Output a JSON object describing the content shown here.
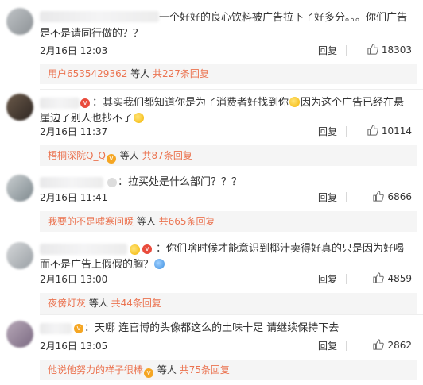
{
  "comments": [
    {
      "text": "一个好好的良心饮料被广告拉下了好多分。。。你们广告是不是请同行做的？？",
      "date": "2月16日 12:03",
      "reply_label": "回复",
      "likes": "18303",
      "thread": {
        "user": "用户6535429362",
        "middle": " 等人 ",
        "count": "共227条回复"
      }
    },
    {
      "text": "：其实我们都知道你是为了消费者好找到你",
      "text2": "因为这个广告已经在悬崖边了别人也抄不了",
      "date": "2月16日 11:37",
      "reply_label": "回复",
      "likes": "10114",
      "thread": {
        "user": "梧桐深院Q_Q",
        "middle": " 等人 ",
        "count": "共87条回复"
      }
    },
    {
      "text": "：拉买处是什么部门？？？",
      "date": "2月16日 11:41",
      "reply_label": "回复",
      "likes": "6866",
      "thread": {
        "user": "我要的不是嘘寒问暖",
        "middle": " 等人 ",
        "count": "共665条回复"
      }
    },
    {
      "text": "：你们啥时候才能意识到椰汁卖得好真的只是因为好喝而不是广告上假假的胸？",
      "date": "2月16日 13:00",
      "reply_label": "回复",
      "likes": "4859",
      "thread": {
        "user": "夜傍灯灰",
        "middle": " 等人 ",
        "count": "共44条回复"
      }
    },
    {
      "text": "：天哪 连官博的头像都这么的土味十足 请继续保持下去",
      "date": "2月16日 13:05",
      "reply_label": "回复",
      "likes": "2862",
      "thread": {
        "user": "他说他努力的样子很棒",
        "middle": " 等人 ",
        "count": "共75条回复"
      }
    }
  ],
  "colors": {
    "link": "#eb7350",
    "reply_bg": "#f5f5f5"
  }
}
